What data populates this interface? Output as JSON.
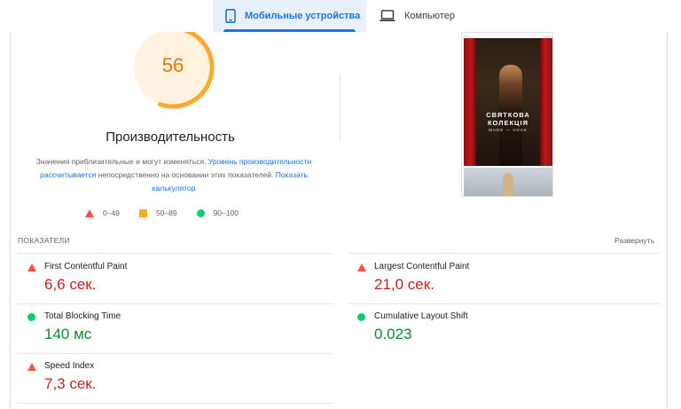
{
  "tabs": {
    "mobile_label": "Мобильные устройства",
    "desktop_label": "Компьютер"
  },
  "performance": {
    "score": "56",
    "title": "Производительность",
    "desc_part1": "Значения приблизительные и могут изменяться. ",
    "desc_link1": "Уровень производительности рассчитывается",
    "desc_part2": " непосредственно на основании этих показателей. ",
    "desc_link2": "Показать калькулятор"
  },
  "legend": {
    "fail": "0–49",
    "average": "50–89",
    "pass": "90–100"
  },
  "screenshot": {
    "title_line1": "СВЯТКОВА",
    "title_line2": "КОЛЕКЦІЯ",
    "subtitle": "MADE — VOVK"
  },
  "metrics": {
    "header": "ПОКАЗАТЕЛИ",
    "expand": "Развернуть",
    "fcp": {
      "name": "First Contentful Paint",
      "value": "6,6 сек."
    },
    "lcp": {
      "name": "Largest Contentful Paint",
      "value": "21,0 сек."
    },
    "tbt": {
      "name": "Total Blocking Time",
      "value": "140 мс"
    },
    "cls": {
      "name": "Cumulative Layout Shift",
      "value": "0.023"
    },
    "si": {
      "name": "Speed Index",
      "value": "7,3 сек."
    }
  },
  "colors": {
    "accent": "#1a73e8",
    "fail": "#ff4e42",
    "average": "#ffa400",
    "pass": "#0cce6b",
    "fail_text": "#c5221f",
    "pass_text": "#0d8a2f"
  }
}
